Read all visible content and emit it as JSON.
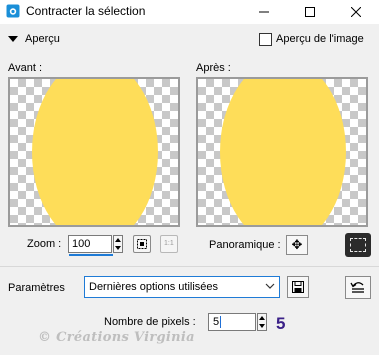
{
  "window": {
    "title": "Contracter la sélection",
    "icon": "camera-icon",
    "controls": [
      "minimize-icon",
      "maximize-icon",
      "close-icon"
    ]
  },
  "preview_bar": {
    "toggle_label": "Aperçu",
    "image_preview_label": "Aperçu de l'image",
    "image_preview_checked": false
  },
  "panels": {
    "before_label": "Avant :",
    "after_label": "Après :",
    "shape_color": "#fedd59"
  },
  "zoom": {
    "label": "Zoom :",
    "value": "100",
    "zoom_100_text": "1:1",
    "pan_label": "Panoramique :"
  },
  "parameters": {
    "label": "Paramètres",
    "preset_value": "Dernières options utilisées"
  },
  "pixels": {
    "label": "Nombre de pixels :",
    "value": "5",
    "annotation": "5"
  },
  "watermark": "© Créations Virginia"
}
